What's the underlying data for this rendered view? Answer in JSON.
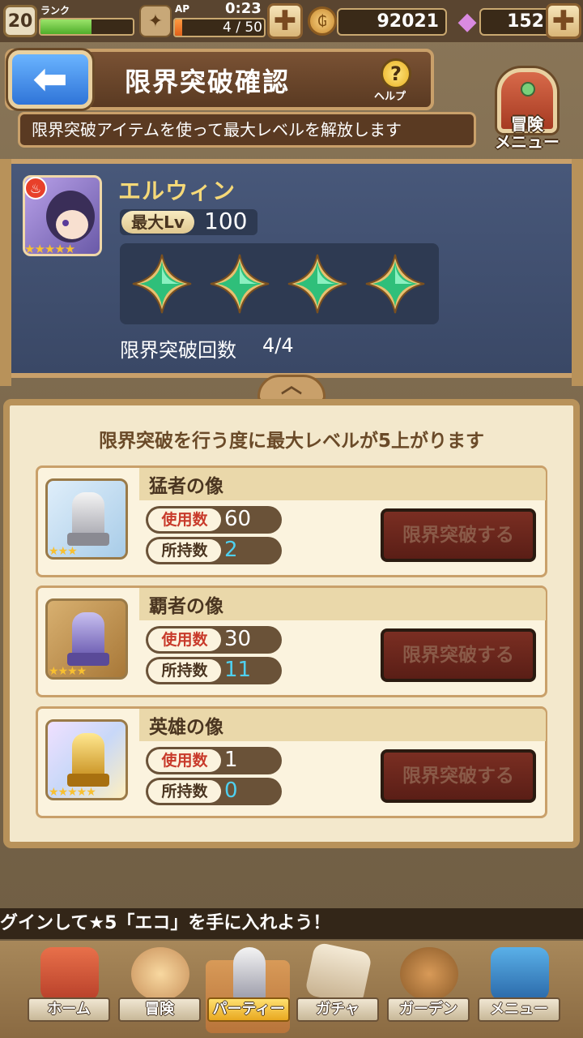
{
  "status": {
    "rank_level": "20",
    "rank_label": "ランク",
    "rank_progress": 0.55,
    "ap_label": "AP",
    "ap_timer": "0:23",
    "ap_value": "4 / 50",
    "ap_progress": 0.08,
    "coins": "92021",
    "gems": "152",
    "plus_glyph": "✚"
  },
  "header": {
    "title": "限界突破確認",
    "help_glyph": "?",
    "help_label": "ヘルプ",
    "subtitle": "限界突破アイテムを使って最大レベルを解放します",
    "menu_label_1": "冒険",
    "menu_label_2": "メニュー"
  },
  "character": {
    "name": "エルウィン",
    "rarity_stars": "★★★★★",
    "max_lv_label": "最大Lv",
    "max_lv": "100",
    "limit_break_label": "限界突破回数",
    "limit_break_count": "4/4",
    "limit_break_filled": 4,
    "limit_break_total": 4
  },
  "items_panel": {
    "heading": "限界突破を行う度に最大レベルが5上がります",
    "use_label": "使用数",
    "owned_label": "所持数",
    "button_label": "限界突破する",
    "items": [
      {
        "name": "猛者の像",
        "stars": "★★★",
        "use": "60",
        "owned": "2",
        "theme": "silver"
      },
      {
        "name": "覇者の像",
        "stars": "★★★★",
        "use": "30",
        "owned": "11",
        "theme": "violet"
      },
      {
        "name": "英雄の像",
        "stars": "★★★★★",
        "use": "1",
        "owned": "0",
        "theme": "gold"
      }
    ]
  },
  "ticker": "グインして★5「エコ」を手に入れよう！",
  "nav": {
    "items": [
      {
        "label": "ホーム",
        "icon": "home-icon"
      },
      {
        "label": "冒険",
        "icon": "adventure-icon"
      },
      {
        "label": "パーティー",
        "icon": "party-icon",
        "active": true
      },
      {
        "label": "ガチャ",
        "icon": "gacha-icon"
      },
      {
        "label": "ガーデン",
        "icon": "garden-icon"
      },
      {
        "label": "メニュー",
        "icon": "menu-book-icon"
      }
    ]
  },
  "colors": {
    "accent_gold": "#f6d978",
    "owned_blue": "#4ed0f0",
    "use_red": "#c83a2a"
  }
}
